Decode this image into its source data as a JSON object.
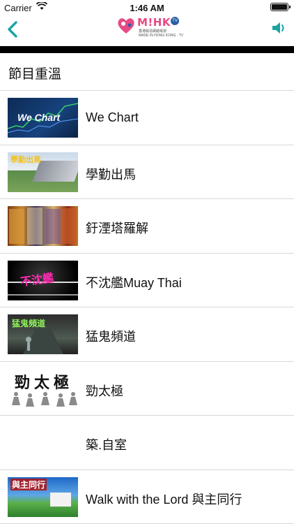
{
  "status_bar": {
    "carrier": "Carrier",
    "time": "1:46 AM"
  },
  "nav": {
    "logo_text_pink": "M!HK",
    "logo_tv": "TV",
    "logo_subtitle": "香港製造網絡電視",
    "logo_tagline": "MADE IN HONG KONG · TV",
    "accent_color": "#1aa3a3"
  },
  "section": {
    "title": "節目重溫"
  },
  "thumb_text": {
    "we_chart": "We Chart",
    "horse": "學勤出馬",
    "muay_thai": "不沈艦",
    "ghost": "猛鬼頻道",
    "taichi": "勁太極",
    "lord": "與主同行"
  },
  "programs": [
    {
      "label": "We Chart",
      "thumb": "we-chart-thumbnail"
    },
    {
      "label": "學勤出馬",
      "thumb": "horse-racing-thumbnail"
    },
    {
      "label": "釪湮塔羅解",
      "thumb": "tarot-thumbnail"
    },
    {
      "label": "不沈艦Muay Thai",
      "thumb": "muay-thai-thumbnail"
    },
    {
      "label": "猛鬼頻道",
      "thumb": "ghost-channel-thumbnail"
    },
    {
      "label": "勁太極",
      "thumb": "tai-chi-thumbnail"
    },
    {
      "label": "築.自室",
      "thumb": ""
    },
    {
      "label": "Walk with the Lord 與主同行",
      "thumb": "walk-with-lord-thumbnail"
    }
  ]
}
